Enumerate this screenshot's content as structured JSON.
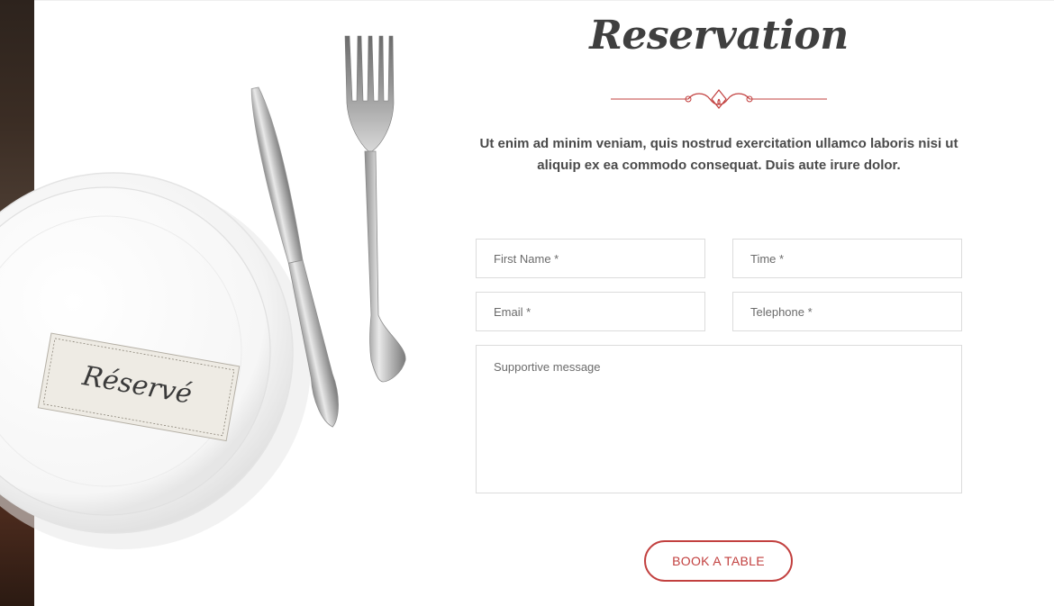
{
  "section": {
    "title": "Reservation",
    "intro": "Ut enim ad minim veniam, quis nostrud exercitation ullamco laboris nisi ut aliquip ex ea commodo consequat. Duis aute irure dolor."
  },
  "illustration": {
    "card_text": "Réservé"
  },
  "form": {
    "first_name_placeholder": "First Name *",
    "time_placeholder": "Time *",
    "email_placeholder": "Email *",
    "telephone_placeholder": "Telephone *",
    "message_placeholder": "Supportive message",
    "submit_label": "BOOK A TABLE"
  },
  "colors": {
    "accent": "#c2403f",
    "title": "#3f3f3f",
    "text": "#4a4a4a"
  }
}
